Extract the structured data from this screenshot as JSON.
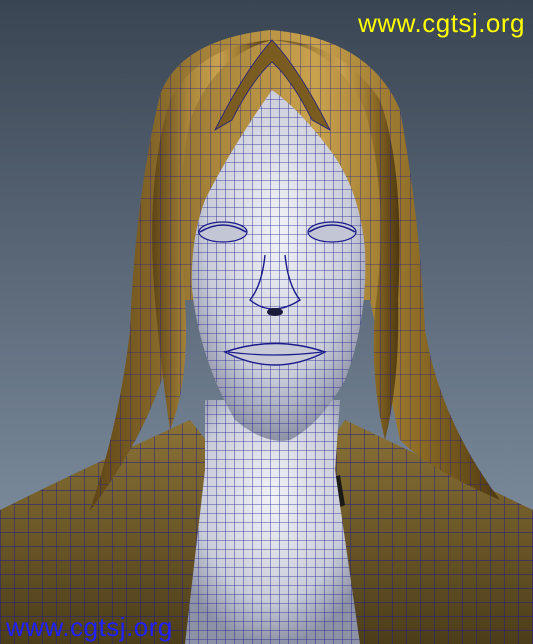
{
  "viewport": {
    "background_top": "#3a4553",
    "background_bottom": "#8a9aab",
    "hair_color": "#9c7a2e",
    "skin_color": "#d9dbe6",
    "wire_color": "#1b1b8a",
    "jacket_color": "#6e5a2c"
  },
  "watermarks": {
    "top": "www.cgtsj.org",
    "bottom": "www.cgtsj.org",
    "top_color": "#ffff00",
    "bottom_color": "#2020ff"
  }
}
